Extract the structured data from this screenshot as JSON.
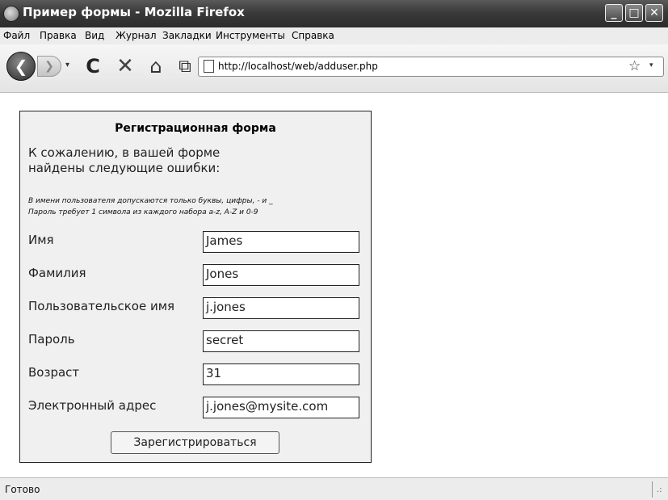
{
  "window": {
    "title": "Пример формы - Mozilla Firefox",
    "buttons": {
      "minimize": "_",
      "maximize": "□",
      "close": "✕"
    }
  },
  "menu": {
    "items": [
      {
        "label": "Файл"
      },
      {
        "label": "Правка"
      },
      {
        "label": "Вид"
      },
      {
        "label": "Журнал"
      },
      {
        "label": "Закладки"
      },
      {
        "label": "Инструменты"
      },
      {
        "label": "Справка"
      }
    ]
  },
  "toolbar": {
    "back_icon": "❮",
    "forward_icon": "❯",
    "dropdown_icon": "▾",
    "reload_icon": "C",
    "stop_icon": "✕",
    "home_icon": "⌂",
    "bookmark_icon": "⧉",
    "url": "http://localhost/web/adduser.php",
    "star_icon": "☆",
    "url_dropdown_icon": "▾"
  },
  "form": {
    "title": "Регистрационная форма",
    "error_heading": "К сожалению, в вашей форме найдены следующие ошибки:",
    "errors": [
      "В имени пользователя допускаются только буквы, цифры, - и _",
      "Пароль требует 1 символа из каждого набора a-z, A-Z и 0-9"
    ],
    "fields": [
      {
        "label": "Имя",
        "value": "James"
      },
      {
        "label": "Фамилия",
        "value": "Jones"
      },
      {
        "label": "Пользовательское имя",
        "value": "j.jones"
      },
      {
        "label": "Пароль",
        "value": "secret"
      },
      {
        "label": "Возраст",
        "value": "31"
      },
      {
        "label": "Электронный адрес",
        "value": "j.jones@mysite.com"
      }
    ],
    "submit_label": "Зарегистрироваться"
  },
  "status": {
    "text": "Готово",
    "grip": ".:"
  },
  "icons": {
    "firefox": "firefox-icon",
    "page": "page-icon"
  }
}
